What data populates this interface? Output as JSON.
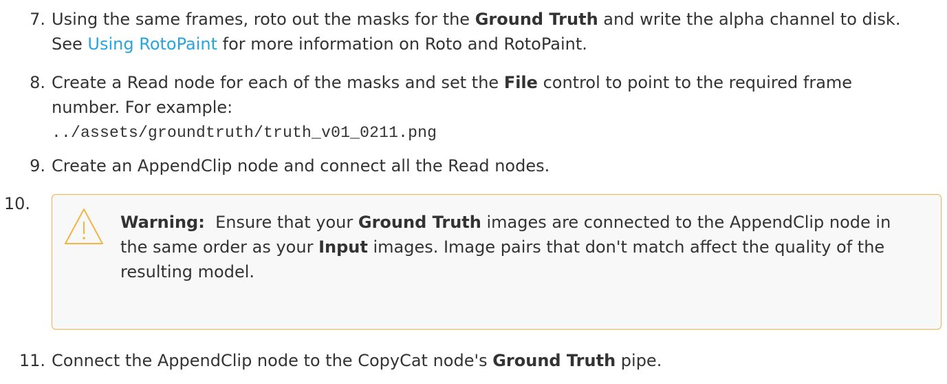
{
  "steps": [
    {
      "number": "7.",
      "parts": [
        "Using the same frames, roto out the masks for the ",
        "Ground Truth",
        " and write the alpha channel to disk.",
        "See ",
        "Using RotoPaint",
        " for more information on Roto and RotoPaint."
      ]
    },
    {
      "number": "8.",
      "parts": [
        "Create a Read node for each of the masks and set the ",
        "File",
        " control to point to the required frame",
        "number. For example:"
      ],
      "code": "../assets/groundtruth/truth_v01_0211.png"
    },
    {
      "number": "9.",
      "text": "Create an AppendClip node and connect all the Read nodes."
    },
    {
      "number": "10.",
      "warning": {
        "label": "Warning:",
        "parts": [
          "Ensure that your ",
          "Ground Truth",
          " images are connected to the AppendClip node in",
          "the same order as your ",
          "Input",
          " images. Image pairs that don't match affect the quality of the",
          "resulting model."
        ]
      }
    },
    {
      "number": "11.",
      "parts": [
        "Connect the AppendClip node to the CopyCat node's ",
        "Ground Truth",
        " pipe."
      ]
    }
  ],
  "colors": {
    "link": "#27a5de",
    "warning_border": "#f2b445",
    "warning_bg": "#f8f8f8",
    "text": "#333333"
  },
  "icons": {
    "warning": "warning-triangle-icon"
  }
}
